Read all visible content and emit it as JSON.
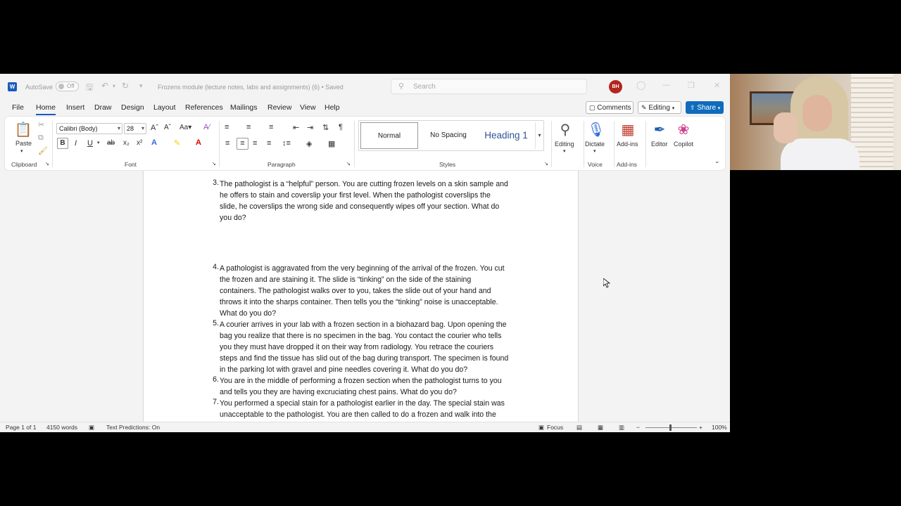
{
  "titlebar": {
    "autosave_label": "AutoSave",
    "autosave_state": "Off",
    "doc_title": "Frozens module (lecture notes, labs and assignments) (6) • Saved",
    "search_placeholder": "Search",
    "avatar_initials": "BH"
  },
  "tabs": [
    "File",
    "Home",
    "Insert",
    "Draw",
    "Design",
    "Layout",
    "References",
    "Mailings",
    "Review",
    "View",
    "Help"
  ],
  "header_buttons": {
    "comments": "Comments",
    "editing": "Editing",
    "share": "Share"
  },
  "ribbon": {
    "paste": "Paste",
    "font_name": "Calibri (Body)",
    "font_size": "28",
    "styles": [
      "Normal",
      "No Spacing",
      "Heading 1"
    ],
    "editing": "Editing",
    "dictate": "Dictate",
    "addins": "Add-ins",
    "editor": "Editor",
    "copilot": "Copilot",
    "groups": {
      "clipboard": "Clipboard",
      "font": "Font",
      "paragraph": "Paragraph",
      "styles": "Styles",
      "voice": "Voice",
      "addins": "Add-ins"
    }
  },
  "document": {
    "items": [
      {
        "num": "3.",
        "lines": [
          "The pathologist is a “helpful” person. You are cutting frozen levels on a skin sample and",
          "he offers to stain and coverslip your first level. When the pathologist coverslips the",
          "slide, he coverslips the wrong side and consequently wipes off your section. What do",
          "you do?"
        ]
      },
      {
        "num": "4.",
        "lines": [
          "A pathologist is aggravated from the very beginning of the arrival of the frozen. You cut",
          "the frozen and are staining it. The slide is “tinking” on the side of the staining",
          "containers. The pathologist walks over to you, takes the slide out of your hand and",
          "throws it into the sharps container. Then tells you the “tinking” noise is unacceptable.",
          "What do you do?"
        ]
      },
      {
        "num": "5.",
        "lines": [
          "A courier arrives in your lab with a frozen section in a biohazard bag. Upon opening the",
          "bag you realize that there is no specimen in the bag. You contact the courier who tells",
          "you they must have dropped it on their way from radiology. You retrace the couriers",
          "steps and find the tissue has slid out of the bag during transport. The specimen is found",
          "in the parking lot with gravel and pine needles covering it. What do you do?"
        ]
      },
      {
        "num": "6.",
        "lines": [
          "You are in the middle of performing a frozen section when the pathologist turns to you",
          "and tells you they are having excruciating chest pains. What do you do?"
        ]
      },
      {
        "num": "7.",
        "lines": [
          "You performed a special stain for a pathologist earlier in the day. The special stain was",
          "unacceptable to the pathologist. You are then called to do a frozen and walk into the"
        ]
      }
    ]
  },
  "statusbar": {
    "page": "Page 1 of 1",
    "words": "4150 words",
    "text_predictions": "Text Predictions: On",
    "focus": "Focus",
    "zoom": "100%"
  }
}
